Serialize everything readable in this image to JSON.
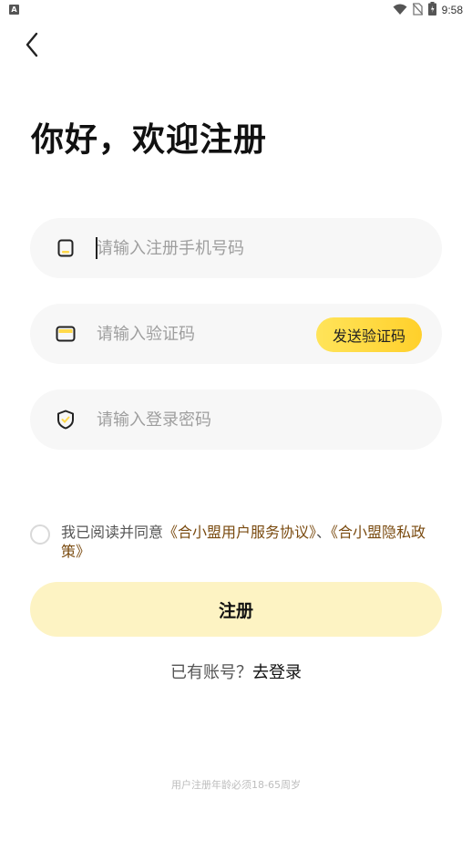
{
  "status_bar": {
    "badge": "A",
    "time": "9:58"
  },
  "title": "你好，欢迎注册",
  "fields": {
    "phone": {
      "placeholder": "请输入注册手机号码",
      "value": ""
    },
    "code": {
      "placeholder": "请输入验证码",
      "value": "",
      "send_label": "发送验证码"
    },
    "password": {
      "placeholder": "请输入登录密码",
      "value": ""
    }
  },
  "agreement": {
    "prefix": "我已阅读并同意",
    "service_link": "《合小盟用户服务协议》",
    "separator": "、",
    "privacy_link": "《合小盟隐私政策》",
    "checked": false
  },
  "register_label": "注册",
  "login": {
    "prompt": "已有账号？",
    "link": "去登录"
  },
  "footer_note": "用户注册年龄必须18-65周岁",
  "colors": {
    "accent": "#ffd94a",
    "register_bg": "#fdf3c3",
    "link": "#7a4b10"
  }
}
